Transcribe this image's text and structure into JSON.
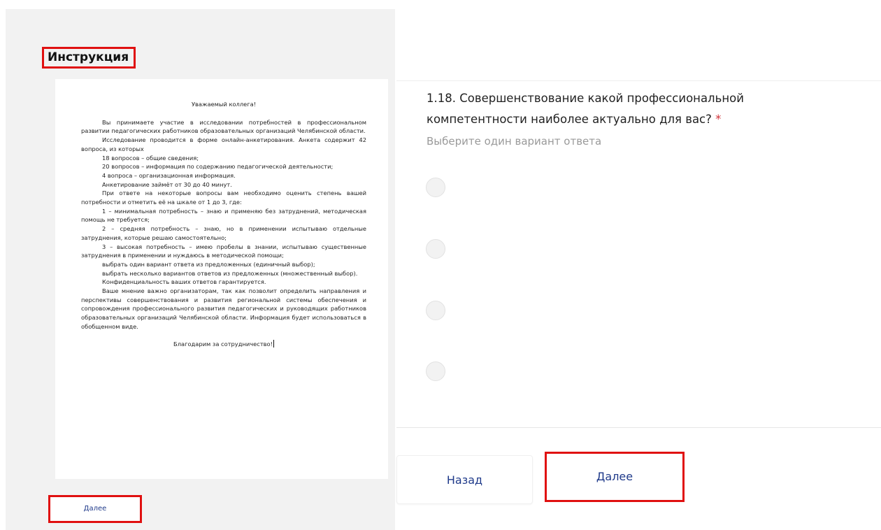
{
  "instruction": {
    "title": "Инструкция",
    "greeting": "Уважаемый коллега!",
    "paragraphs": [
      "Вы принимаете участие в исследовании потребностей в профессиональном развитии педагогических работников образовательных организаций Челябинской области.",
      "Исследование проводится в форме онлайн-анкетирования. Анкета содержит 42 вопроса, из которых",
      "18 вопросов – общие сведения;",
      "20 вопросов – информация по содержанию педагогической деятельности;",
      "4 вопроса – организационная информация.",
      "Анкетирование займёт от 30 до 40 минут.",
      "При ответе на некоторые вопросы вам необходимо оценить степень вашей потребности и отметить её на шкале от 1 до 3, где:",
      "1 – минимальная потребность – знаю и применяю без затруднений, методическая помощь не требуется;",
      "2 – средняя потребность – знаю, но в применении испытываю отдельные затруднения, которые решаю самостоятельно;",
      "3 – высокая потребность – имею пробелы в знании, испытываю существенные затруднения в применении и нуждаюсь в методической помощи;",
      "выбрать один вариант ответа из предложенных (единичный выбор);",
      "выбрать несколько вариантов ответов из предложенных (множественный выбор).",
      "Конфиденциальность ваших ответов гарантируется.",
      "Ваше мнение важно организаторам, так как позволит определить направления и перспективы совершенствования и развития региональной системы обеспечения и сопровождения профессионального развития педагогических и руководящих работников образовательных организаций Челябинской области. Информация будет использоваться в обобщенном виде."
    ],
    "thanks": "Благодарим за сотрудничество!",
    "next_label": "Далее"
  },
  "question": {
    "title": "1.18. Совершенствование какой профессиональной компетентности наиболее актуально для вас?",
    "required_mark": "*",
    "hint": "Выберите один вариант ответа"
  },
  "buttons": {
    "back_label": "Назад",
    "next_label": "Далее"
  },
  "colors": {
    "accent_text": "#1f3a8a",
    "highlight_border": "#e01010",
    "required": "#d0343a"
  }
}
